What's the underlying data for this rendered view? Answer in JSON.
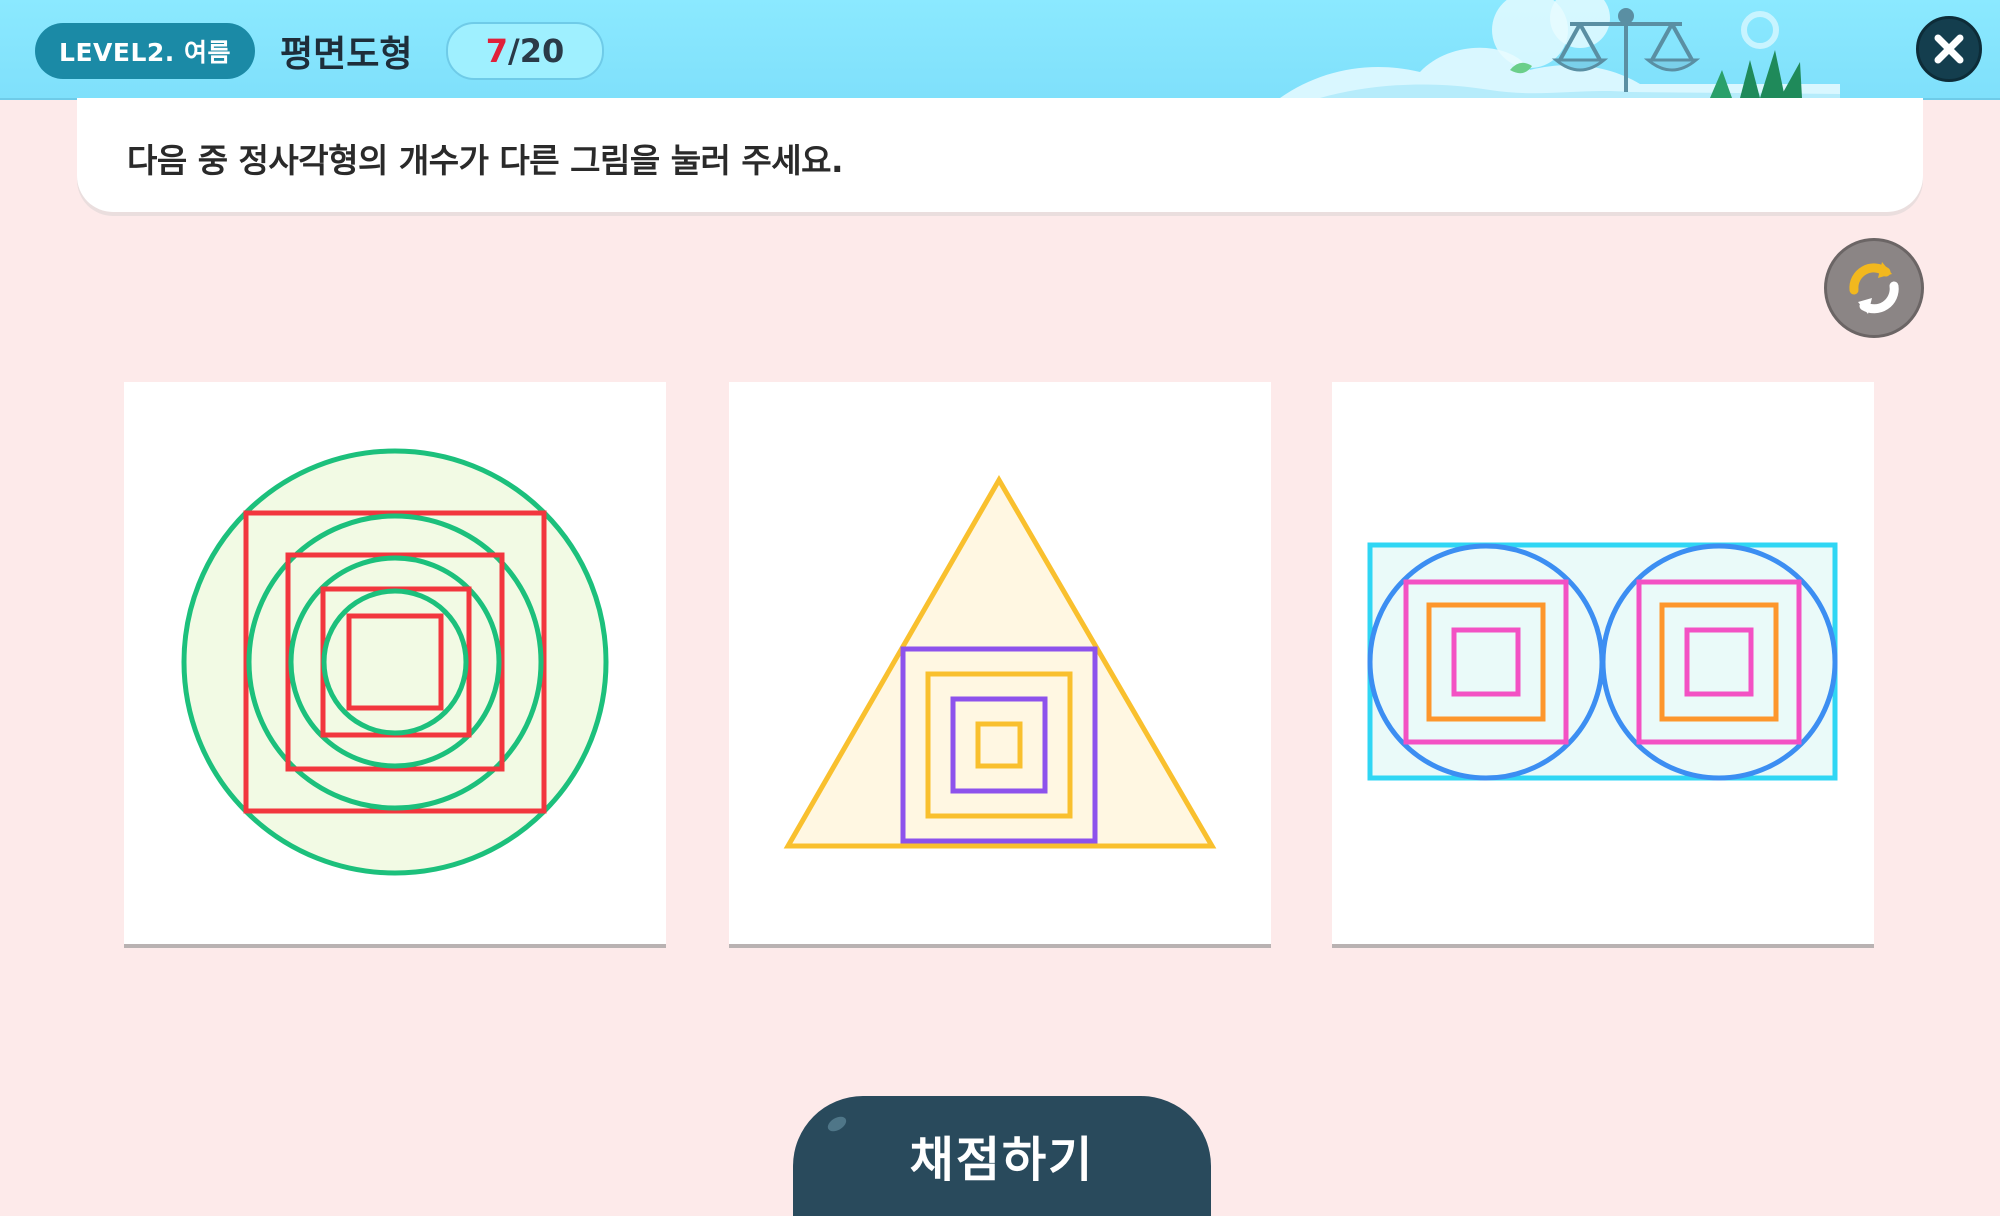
{
  "header": {
    "level_label": "LEVEL2. 여름",
    "subject_title": "평면도형",
    "progress_current": "7",
    "progress_total": "/20"
  },
  "question": {
    "text": "다음 중 정사각형의 개수가 다른 그림을 눌러 주세요."
  },
  "choices": [
    {
      "figure": "circles-and-squares",
      "square_count": 4,
      "circle_count": 4
    },
    {
      "figure": "triangle-and-squares",
      "square_count": 4,
      "triangle_count": 1
    },
    {
      "figure": "rectangle-circles-and-squares",
      "square_count": 6,
      "circle_count": 2,
      "rectangle_count": 1
    }
  ],
  "actions": {
    "grade_label": "채점하기",
    "close_icon": "close-icon",
    "reset_icon": "refresh-icon"
  },
  "colors": {
    "header_bg": "#8be9ff",
    "level_pill": "#1b8aa6",
    "page_bg": "#fdeaea",
    "grade_button": "#294a5c",
    "progress_current": "#e0203a"
  }
}
